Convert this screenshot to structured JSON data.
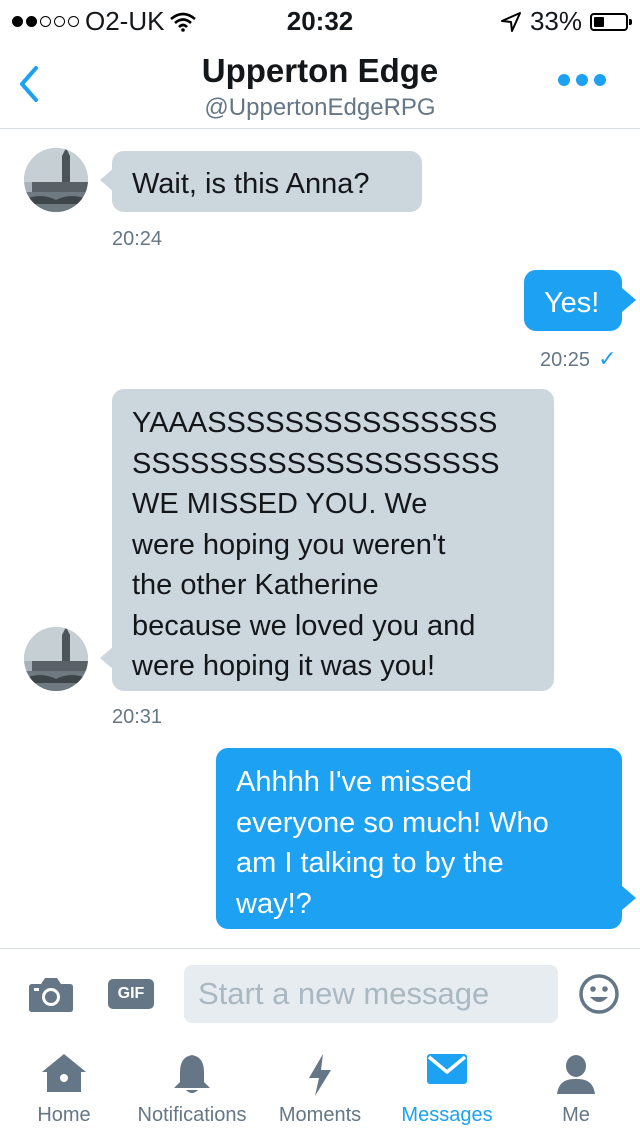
{
  "status_bar": {
    "carrier": "O2-UK",
    "time": "20:32",
    "battery": "33%",
    "battery_level": 0.33,
    "signal_bars_filled": 2,
    "signal_bars_total": 5
  },
  "header": {
    "title": "Upperton Edge",
    "handle": "@UppertonEdgeRPG",
    "accent_color": "#1da1f2"
  },
  "messages": [
    {
      "direction": "in",
      "text": "Wait, is this Anna?",
      "time": "20:24"
    },
    {
      "direction": "out",
      "text": "Yes!",
      "time": "20:25",
      "read_mark": "✓"
    },
    {
      "direction": "in",
      "lines": [
        "YAAASSSSSSSSSSSSSSS",
        "SSSSSSSSSSSSSSSSSSS",
        "WE MISSED YOU. We",
        "were hoping you weren't",
        "the other Katherine",
        "because we loved you and",
        "were hoping it was you!"
      ],
      "time": "20:31"
    },
    {
      "direction": "out",
      "lines": [
        "Ahhhh I've missed",
        "everyone so much! Who",
        "am I talking to by the",
        "way!?"
      ]
    }
  ],
  "composer": {
    "camera_icon": "camera-icon",
    "gif_label": "GIF",
    "placeholder": "Start a new message",
    "emoji_icon": "smiley-icon"
  },
  "tabs": [
    {
      "label": "Home",
      "icon": "home-icon"
    },
    {
      "label": "Notifications",
      "icon": "bell-icon"
    },
    {
      "label": "Moments",
      "icon": "lightning-icon"
    },
    {
      "label": "Messages",
      "icon": "envelope-icon",
      "active": true
    },
    {
      "label": "Me",
      "icon": "person-icon"
    }
  ],
  "colors": {
    "incoming_bubble": "#ccd6dd",
    "outgoing_bubble": "#1da1f2",
    "secondary_text": "#657786"
  }
}
